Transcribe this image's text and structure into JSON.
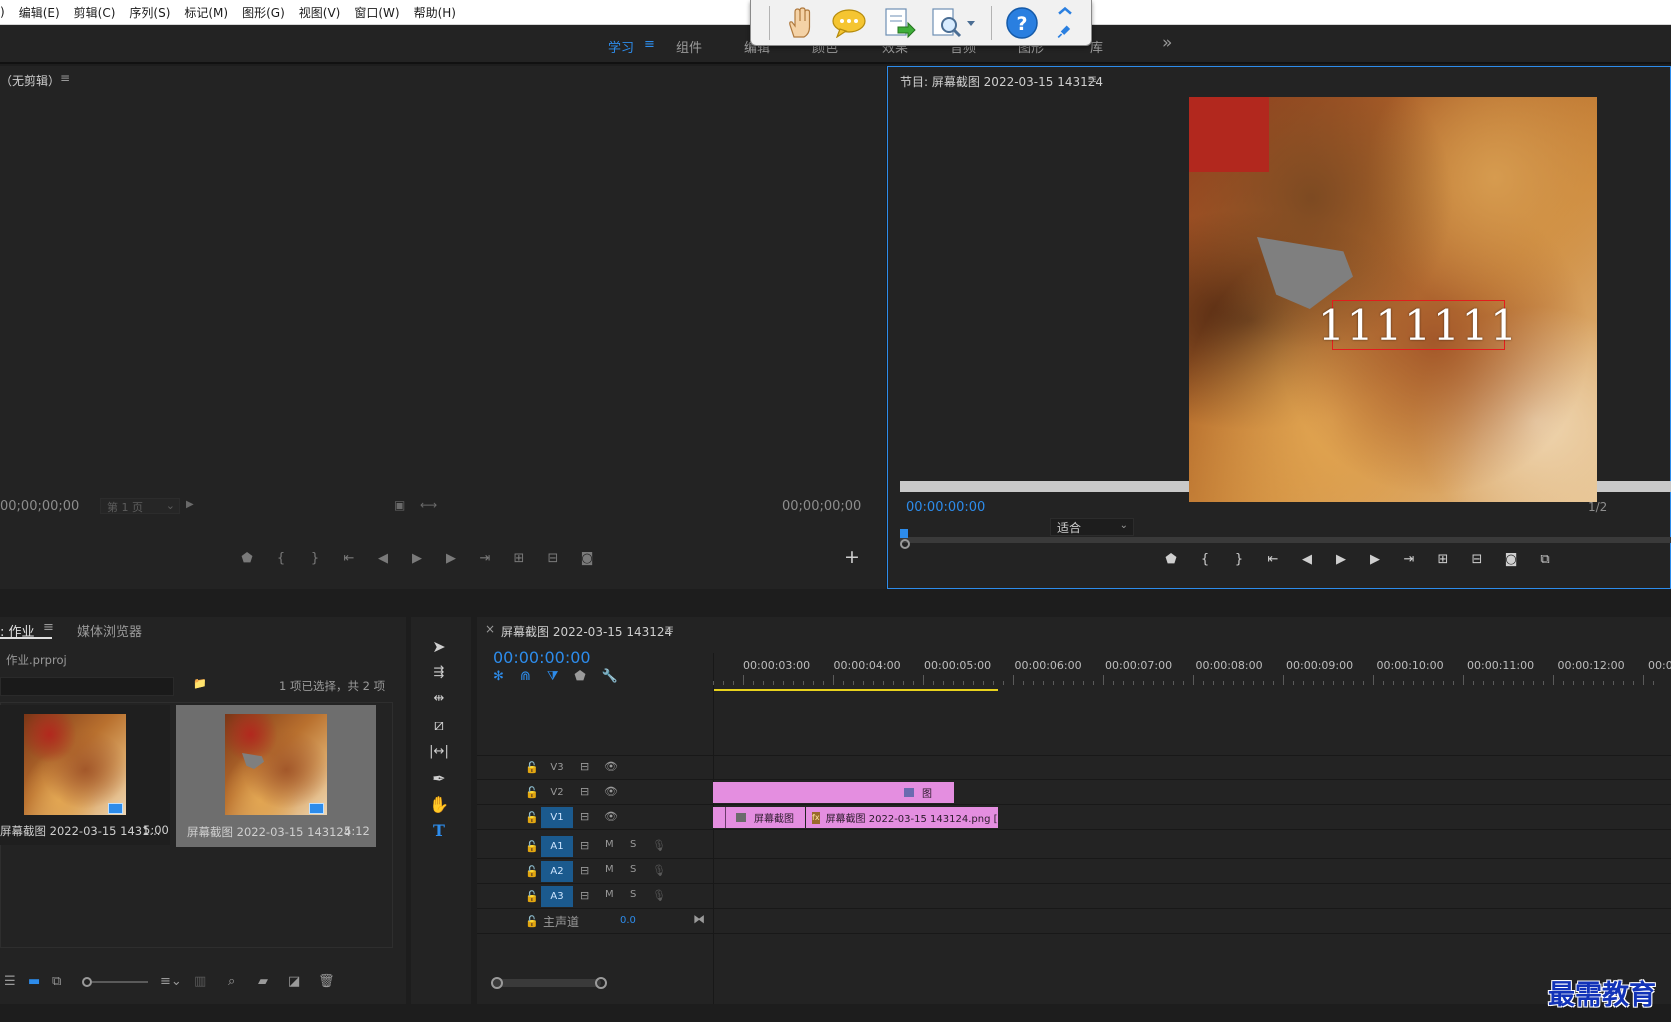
{
  "menu": [
    "编辑(E)",
    "剪辑(C)",
    "序列(S)",
    "标记(M)",
    "图形(G)",
    "视图(V)",
    "窗口(W)",
    "帮助(H)"
  ],
  "workspaces": {
    "learn": "学习",
    "assembly": "组件",
    "editing": "编辑",
    "color": "颜色",
    "effects": "效果",
    "audio": "音频",
    "graphics": "图形",
    "libraries": "库",
    "more": "»"
  },
  "source": {
    "title": "（无剪辑）",
    "timecode_left": "00;00;00;00",
    "page_select": "第 1 页",
    "timecode_right": "00;00;00;00"
  },
  "program": {
    "title": "节目: 屏幕截图 2022-03-15 143124",
    "timecode": "00:00:00:00",
    "fit": "适合",
    "quality": "1/2",
    "overlay_text": "1111111"
  },
  "project": {
    "tab_project": "作业",
    "tab_media": "媒体浏览器",
    "filename": "作业.prproj",
    "selection_info": "1 项已选择，共 2 项",
    "items": [
      {
        "name": "屏幕截图 2022-03-15 1431...",
        "duration": "5:00"
      },
      {
        "name": "屏幕截图 2022-03-15 143124",
        "duration": "5:12"
      }
    ]
  },
  "timeline": {
    "sequence_name": "屏幕截图 2022-03-15 143124",
    "timecode": "00:00:00:00",
    "ruler": [
      "00:00:03:00",
      "00:00:04:00",
      "00:00:05:00",
      "00:00:06:00",
      "00:00:07:00",
      "00:00:08:00",
      "00:00:09:00",
      "00:00:10:00",
      "00:00:11:00",
      "00:00:12:00",
      "00:0"
    ],
    "tracks": {
      "v3": "V3",
      "v2": "V2",
      "v1": "V1",
      "a1": "A1",
      "a2": "A2",
      "a3": "A3",
      "master": "主声道",
      "master_value": "0.0",
      "m": "M",
      "s": "S"
    },
    "clips": {
      "v2_label": "图",
      "v1_a": "屏幕截图",
      "v1_b": "屏幕截图 2022-03-15 143124.png [7"
    }
  },
  "watermark": "最需教育",
  "colors": {
    "accent": "#2d8ceb",
    "clip": "#e48ee0",
    "track_active": "#1b5a8e"
  }
}
